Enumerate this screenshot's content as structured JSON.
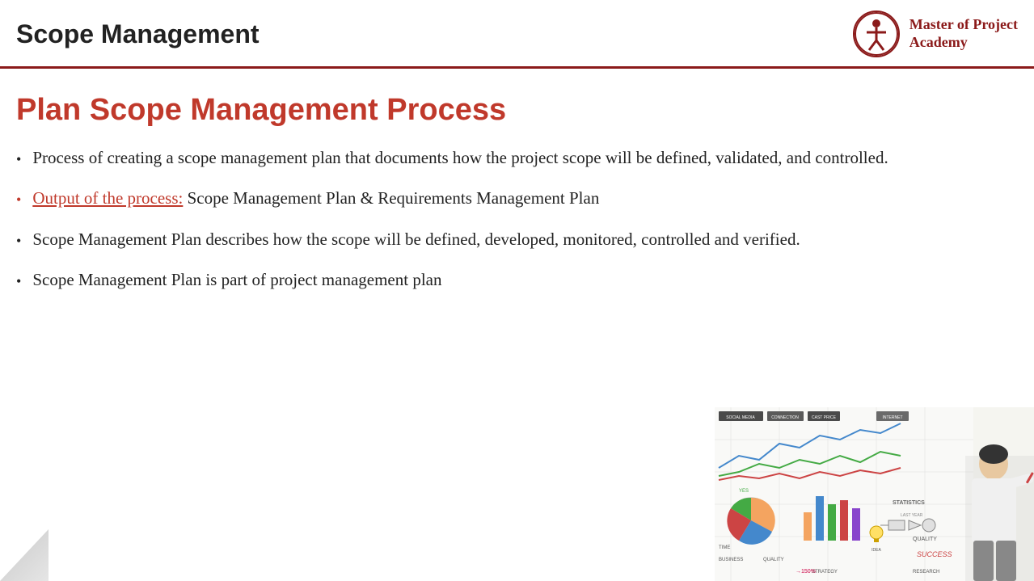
{
  "header": {
    "title": "Scope Management",
    "logo": {
      "name": "Master of Project Academy",
      "line1": "Master of Project",
      "line2": "Academy"
    }
  },
  "main": {
    "slide_title": "Plan Scope Management Process",
    "bullets": [
      {
        "id": 1,
        "highlight": false,
        "text": "Process of creating a scope management plan that documents how the project scope will be defined, validated, and controlled.",
        "link_text": null
      },
      {
        "id": 2,
        "highlight": true,
        "text": " Scope Management Plan & Requirements Management Plan",
        "link_text": "Output of the process:"
      },
      {
        "id": 3,
        "highlight": false,
        "text": "Scope Management Plan describes  how the scope will be defined, developed, monitored, controlled and verified.",
        "link_text": null
      },
      {
        "id": 4,
        "highlight": false,
        "text": "Scope Management Plan is part of project management plan",
        "link_text": null
      }
    ]
  }
}
